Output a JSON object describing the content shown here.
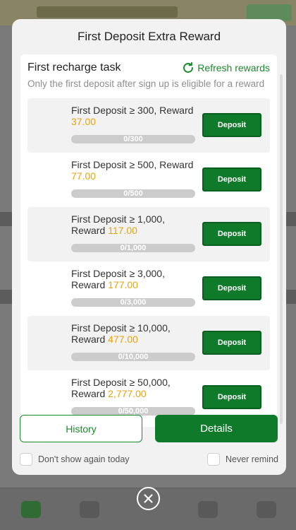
{
  "modal": {
    "title": "First Deposit Extra Reward",
    "task_title": "First recharge task",
    "refresh_label": "Refresh rewards",
    "note": "Only the first deposit after sign up is eligible for a reward",
    "tasks": [
      {
        "label": "First Deposit ≥ 300, Reward ",
        "reward": "37.00",
        "progress_text": "0/300",
        "progress": 0,
        "button": "Deposit",
        "shaded": true
      },
      {
        "label": "First Deposit ≥ 500, Reward ",
        "reward": "77.00",
        "progress_text": "0/500",
        "progress": 0,
        "button": "Deposit",
        "shaded": false
      },
      {
        "label": "First Deposit ≥ 1,000, Reward ",
        "reward": "117.00",
        "progress_text": "0/1,000",
        "progress": 0,
        "button": "Deposit",
        "shaded": true
      },
      {
        "label": "First Deposit ≥ 3,000, Reward ",
        "reward": "177.00",
        "progress_text": "0/3,000",
        "progress": 0,
        "button": "Deposit",
        "shaded": false
      },
      {
        "label": "First Deposit ≥ 10,000, Reward ",
        "reward": "477.00",
        "progress_text": "0/10,000",
        "progress": 0,
        "button": "Deposit",
        "shaded": true
      },
      {
        "label": "First Deposit ≥ 50,000, Reward ",
        "reward": "2,777.00",
        "progress_text": "0/50,000",
        "progress": 0,
        "button": "Deposit",
        "shaded": false
      }
    ],
    "history_label": "History",
    "details_label": "Details",
    "dont_show_today": "Don't show again today",
    "never_remind": "Never remind"
  },
  "colors": {
    "accent": "#0f7a2a",
    "reward": "#e7a411",
    "progress_track": "#cccccc"
  }
}
